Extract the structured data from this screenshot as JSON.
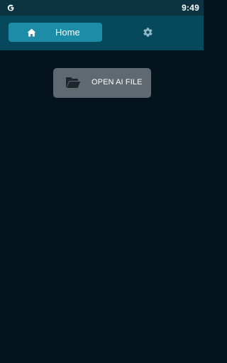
{
  "status_bar": {
    "time": "9:49",
    "notification_icon": "google-g-icon"
  },
  "nav": {
    "home_label": "Home",
    "home_icon": "home-icon",
    "settings_icon": "gear-icon"
  },
  "main": {
    "open_button_label": "OPEN AI FILE",
    "open_button_icon": "folder-open-icon"
  },
  "colors": {
    "background": "#03141c",
    "status_bar": "#0b3341",
    "app_bar": "#07495c",
    "active_tab": "#1d8ca6",
    "button": "#5f6970"
  }
}
